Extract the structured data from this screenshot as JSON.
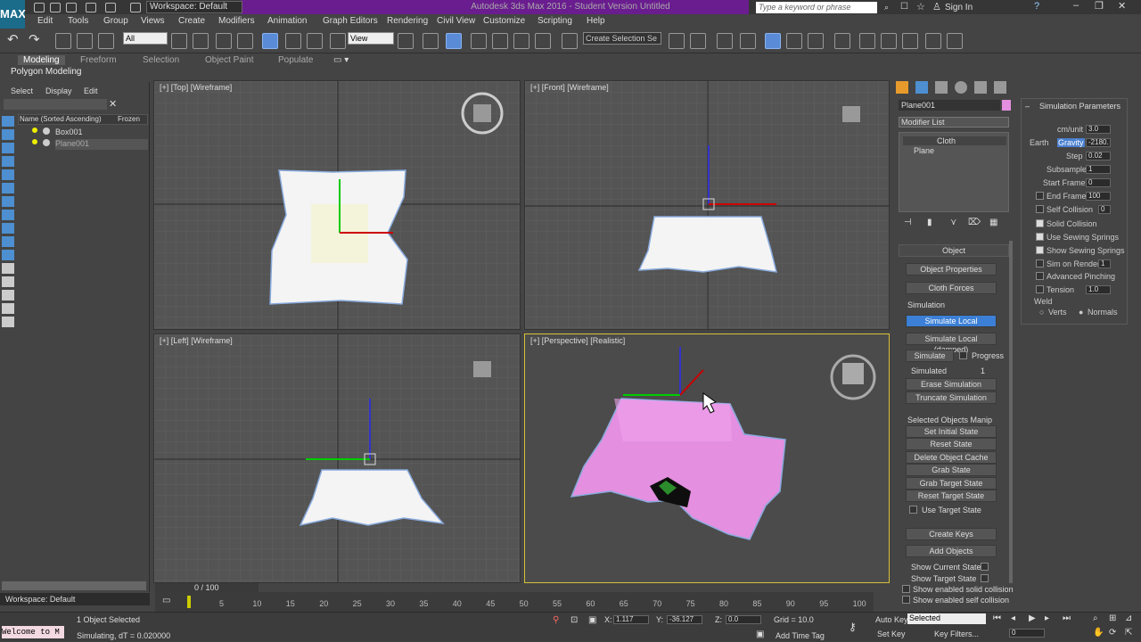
{
  "titlebar": {
    "app_title": "Autodesk 3ds Max 2016 - Student Version   Untitled",
    "workspace": "Workspace: Default",
    "search_placeholder": "Type a keyword or phrase",
    "sign_in": "Sign In",
    "logo": "MAX"
  },
  "menus": [
    "Edit",
    "Tools",
    "Group",
    "Views",
    "Create",
    "Modifiers",
    "Animation",
    "Graph Editors",
    "Rendering",
    "Civil View",
    "Customize",
    "Scripting",
    "Help"
  ],
  "toolbar": {
    "filter": "All",
    "coord": "View",
    "selection_set": "Create Selection Se"
  },
  "ribbon": {
    "tabs": [
      "Modeling",
      "Freeform",
      "Selection",
      "Object Paint",
      "Populate"
    ],
    "subtitle": "Polygon Modeling"
  },
  "scene_explorer": {
    "menus": [
      "Select",
      "Display",
      "Edit"
    ],
    "col_name": "Name (Sorted Ascending)",
    "col_frozen": "Frozen",
    "items": [
      "Box001",
      "Plane001"
    ]
  },
  "viewports": {
    "top": "[+] [Top] [Wireframe]",
    "front": "[+] [Front] [Wireframe]",
    "left": "[+] [Left] [Wireframe]",
    "persp": "[+] [Perspective] [Realistic]"
  },
  "command": {
    "object_name": "Plane001",
    "modifier_list": "Modifier List",
    "stack": [
      "Cloth",
      "Plane"
    ],
    "object_rollout": "Object",
    "buttons1": [
      "Object Properties",
      "Cloth Forces"
    ],
    "simulation_label": "Simulation",
    "sim_buttons": [
      "Simulate Local",
      "Simulate Local (damped)"
    ],
    "simulate": "Simulate",
    "progress": "Progress",
    "simulated_label": "Simulated",
    "simulated_value": "1",
    "sim_buttons2": [
      "Erase Simulation",
      "Truncate Simulation"
    ],
    "manip_label": "Selected Objects Manip",
    "manip_buttons": [
      "Set Initial State",
      "Reset State",
      "Delete Object Cache",
      "Grab State",
      "Grab Target State",
      "Reset Target State"
    ],
    "use_target": "Use Target State",
    "keys_buttons": [
      "Create Keys",
      "Add Objects"
    ],
    "show_options": [
      "Show Current State",
      "Show Target State",
      "Show enabled solid collision",
      "Show enabled self collision"
    ]
  },
  "sim_params": {
    "title": "Simulation Parameters",
    "cm_unit_label": "cm/unit",
    "cm_unit": "3.0",
    "earth": "Earth",
    "gravity_label": "Gravity",
    "gravity": "-2180.",
    "step_label": "Step",
    "step": "0.02",
    "subsample_label": "Subsample",
    "subsample": "1",
    "start_label": "Start Frame",
    "start": "0",
    "end_label": "End Frame",
    "end": "100",
    "self_collision_label": "Self Collision",
    "self_collision": "0",
    "solid_collision": "Solid Collision",
    "sewing": "Use Sewing Springs",
    "show_sewing": "Show Sewing Springs",
    "sim_on_render": "Sim on Render",
    "sim_on_render_val": "1",
    "advanced": "Advanced Pinching",
    "tension_label": "Tension",
    "tension": "1.0",
    "weld": "Weld",
    "verts": "Verts",
    "normals": "Normals"
  },
  "timeline": {
    "frame": "0 / 100",
    "ticks": [
      "5",
      "10",
      "15",
      "20",
      "25",
      "30",
      "35",
      "40",
      "45",
      "50",
      "55",
      "60",
      "65",
      "70",
      "75",
      "80",
      "85",
      "90",
      "95",
      "100"
    ]
  },
  "status": {
    "workspace": "Workspace: Default",
    "selected": "1 Object Selected",
    "message": "Simulating, dT = 0.020000",
    "welcome": "Welcome to M",
    "x": "1.117",
    "y": "-36.127",
    "z": "0.0",
    "grid": "Grid = 10.0",
    "time_tag": "Add Time Tag",
    "auto_key": "Auto Key",
    "auto_key_mode": "Selected",
    "set_key": "Set Key",
    "key_filters": "Key Filters...",
    "frame_field": "0"
  }
}
